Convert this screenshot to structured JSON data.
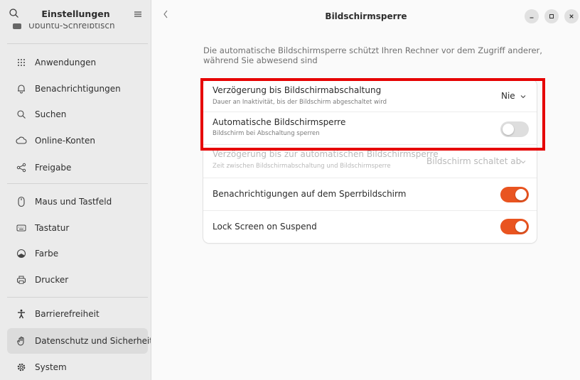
{
  "sidebar": {
    "title": "Einstellungen",
    "cut_item": "Ubuntu-Schreibtisch",
    "items": [
      {
        "label": "Anwendungen",
        "icon": "grid-icon"
      },
      {
        "label": "Benachrichtigungen",
        "icon": "bell-icon"
      },
      {
        "label": "Suchen",
        "icon": "search-icon"
      },
      {
        "label": "Online-Konten",
        "icon": "cloud-icon"
      },
      {
        "label": "Freigabe",
        "icon": "share-icon"
      },
      {
        "label": "Maus und Tastfeld",
        "icon": "mouse-icon"
      },
      {
        "label": "Tastatur",
        "icon": "keyboard-icon"
      },
      {
        "label": "Farbe",
        "icon": "color-icon"
      },
      {
        "label": "Drucker",
        "icon": "printer-icon"
      },
      {
        "label": "Barrierefreiheit",
        "icon": "accessibility-icon"
      },
      {
        "label": "Datenschutz und Sicherheit",
        "icon": "hand-icon"
      },
      {
        "label": "System",
        "icon": "gear-icon"
      }
    ]
  },
  "main": {
    "title": "Bildschirmsperre",
    "description": "Die automatische Bildschirmsperre schützt Ihren Rechner vor dem Zugriff anderer, während Sie abwesend sind",
    "rows": [
      {
        "title": "Verzögerung bis Bildschirmabschaltung",
        "subtitle": "Dauer an Inaktivität, bis der Bildschirm abgeschaltet wird",
        "value": "Nie"
      },
      {
        "title": "Automatische Bildschirmsperre",
        "subtitle": "Bildschirm bei Abschaltung sperren",
        "toggle": "off"
      },
      {
        "title": "Verzögerung bis zur automatischen Bildschirmsperre",
        "subtitle": "Zeit zwischen Bildschirmabschaltung und Bildschirmsperre",
        "value": "Bildschirm schaltet ab"
      },
      {
        "title": "Benachrichtigungen auf dem Sperrbildschirm",
        "toggle": "on"
      },
      {
        "title": "Lock Screen on Suspend",
        "toggle": "on"
      }
    ]
  },
  "colors": {
    "accent": "#e95420",
    "highlight": "#e60000"
  }
}
